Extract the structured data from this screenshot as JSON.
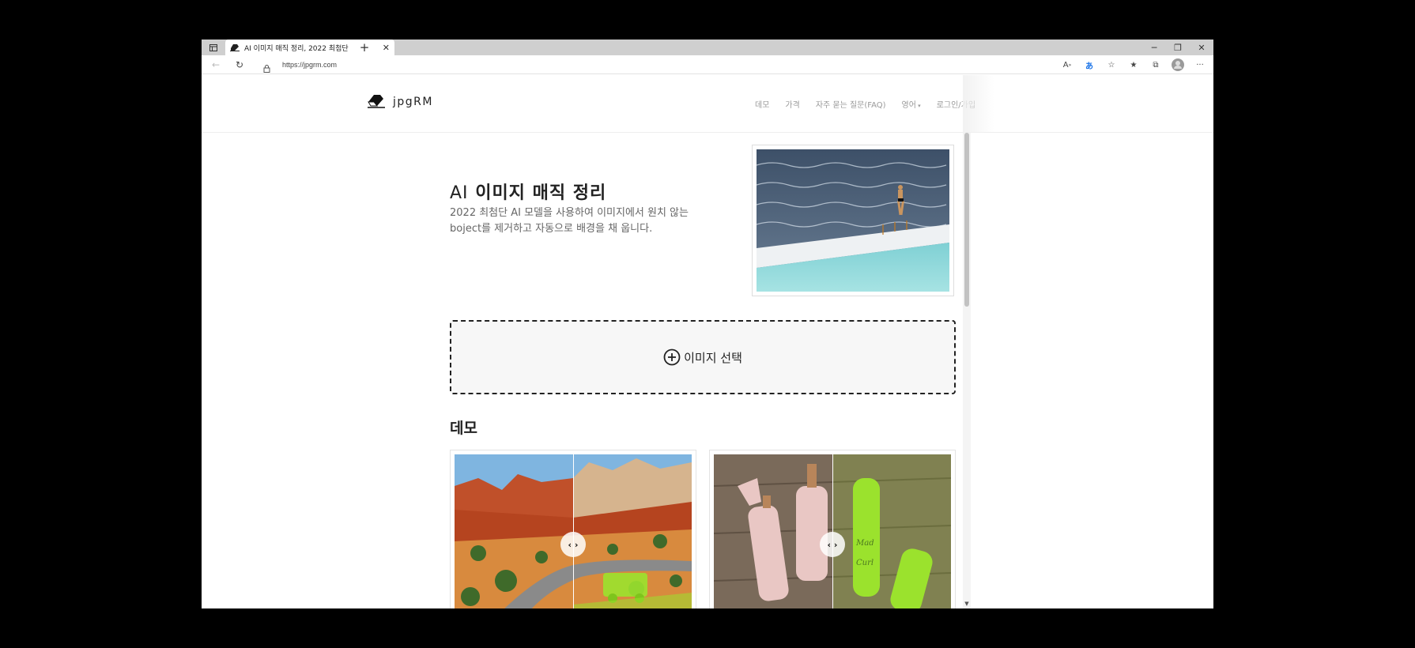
{
  "browser": {
    "tab_title": "AI 이미지 매직 정리, 2022 최첨단",
    "url": "https://jpgrm.com"
  },
  "nav": {
    "brand": "jpgRM",
    "items": [
      "데모",
      "가격",
      "자주 묻는 질문(FAQ)",
      "영어",
      "로그인/가입"
    ]
  },
  "hero": {
    "title_prefix": "AI",
    "title_rest": " 이미지 매직 정리",
    "subtitle": "2022 최첨단 AI 모델을 사용하여 이미지에서 원치 않는 boject를 제거하고 자동으로 배경을 채 웁니다."
  },
  "upload": {
    "label": "이미지 선택"
  },
  "demo": {
    "title": "데모"
  },
  "colors": {
    "accent_mask": "#9be22d",
    "text_primary": "#222222",
    "nav_text": "#999999"
  }
}
